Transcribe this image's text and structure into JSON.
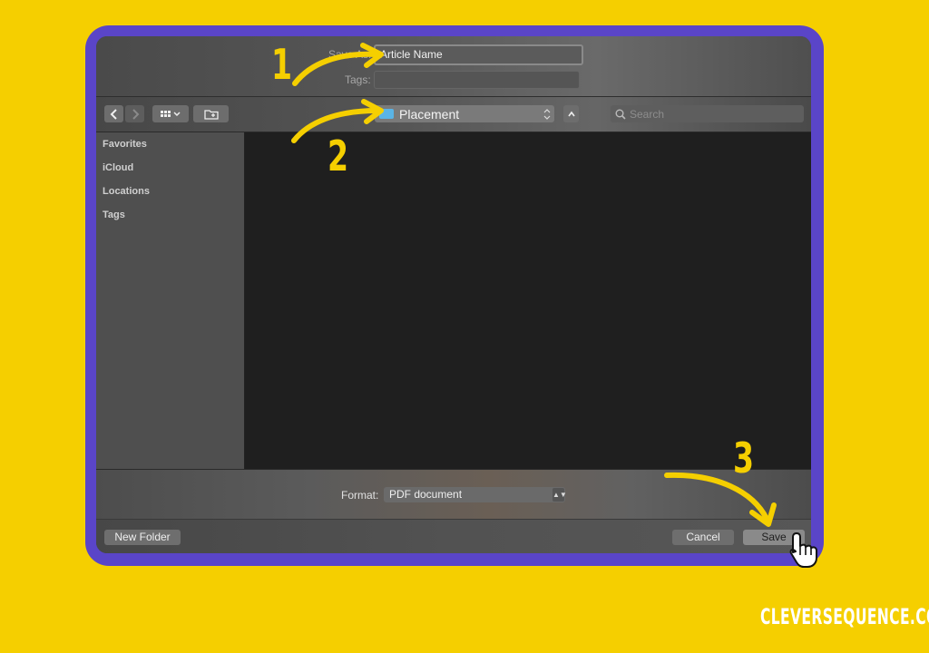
{
  "dialog": {
    "name_label": "Save As:",
    "name_value": "Article Name",
    "tags_label": "Tags:",
    "location_value": "Placement",
    "search_placeholder": "Search"
  },
  "sidebar": {
    "items": [
      {
        "label": "Favorites"
      },
      {
        "label": "iCloud"
      },
      {
        "label": "Locations"
      },
      {
        "label": "Tags"
      }
    ]
  },
  "format": {
    "label": "Format:",
    "selected": "PDF document"
  },
  "buttons": {
    "new_folder": "New Folder",
    "cancel": "Cancel",
    "save": "Save"
  },
  "annotations": {
    "step1": "1",
    "step2": "2",
    "step3": "3",
    "color": "#f5cf00"
  },
  "watermark": "CLEVERSEQUENCE.COM",
  "colors": {
    "background": "#f5cf00",
    "frame": "#5a45c8",
    "folder": "#5ab4e6"
  }
}
